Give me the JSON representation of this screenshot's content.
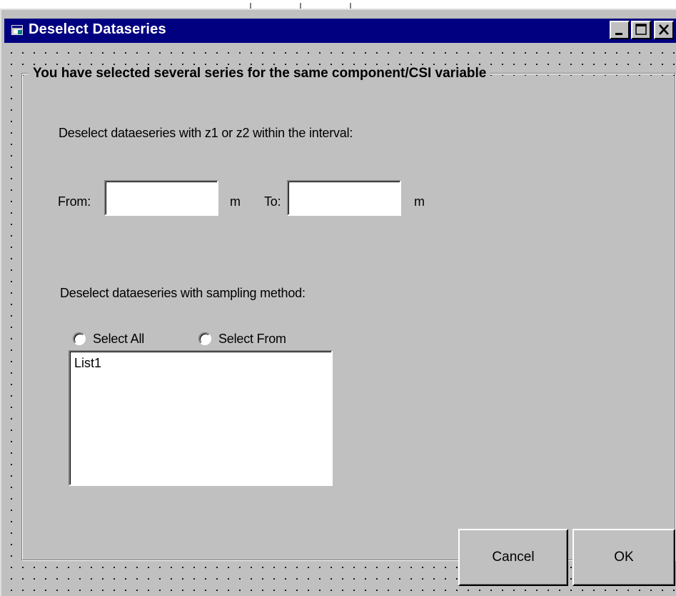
{
  "window": {
    "title": "Deselect Dataseries",
    "icon": "form-icon",
    "controls": [
      "minimize-icon",
      "maximize-icon",
      "close-icon"
    ]
  },
  "frame": {
    "caption": "You have selected several series for the same component/CSI variable"
  },
  "interval": {
    "instruction": "Deselect dataeseries with z1 or z2 within the interval:",
    "from_label": "From:",
    "from_value": "",
    "from_unit": "m",
    "to_label": "To:",
    "to_value": "",
    "to_unit": "m"
  },
  "sampling": {
    "instruction": "Deselect dataeseries with sampling method:",
    "radio_select_all": "Select All",
    "radio_select_from": "Select From",
    "list_items": [
      "List1"
    ]
  },
  "buttons": {
    "cancel": "Cancel",
    "ok": "OK"
  },
  "colors": {
    "titlebar": "#000080",
    "face": "#c0c0c0"
  }
}
